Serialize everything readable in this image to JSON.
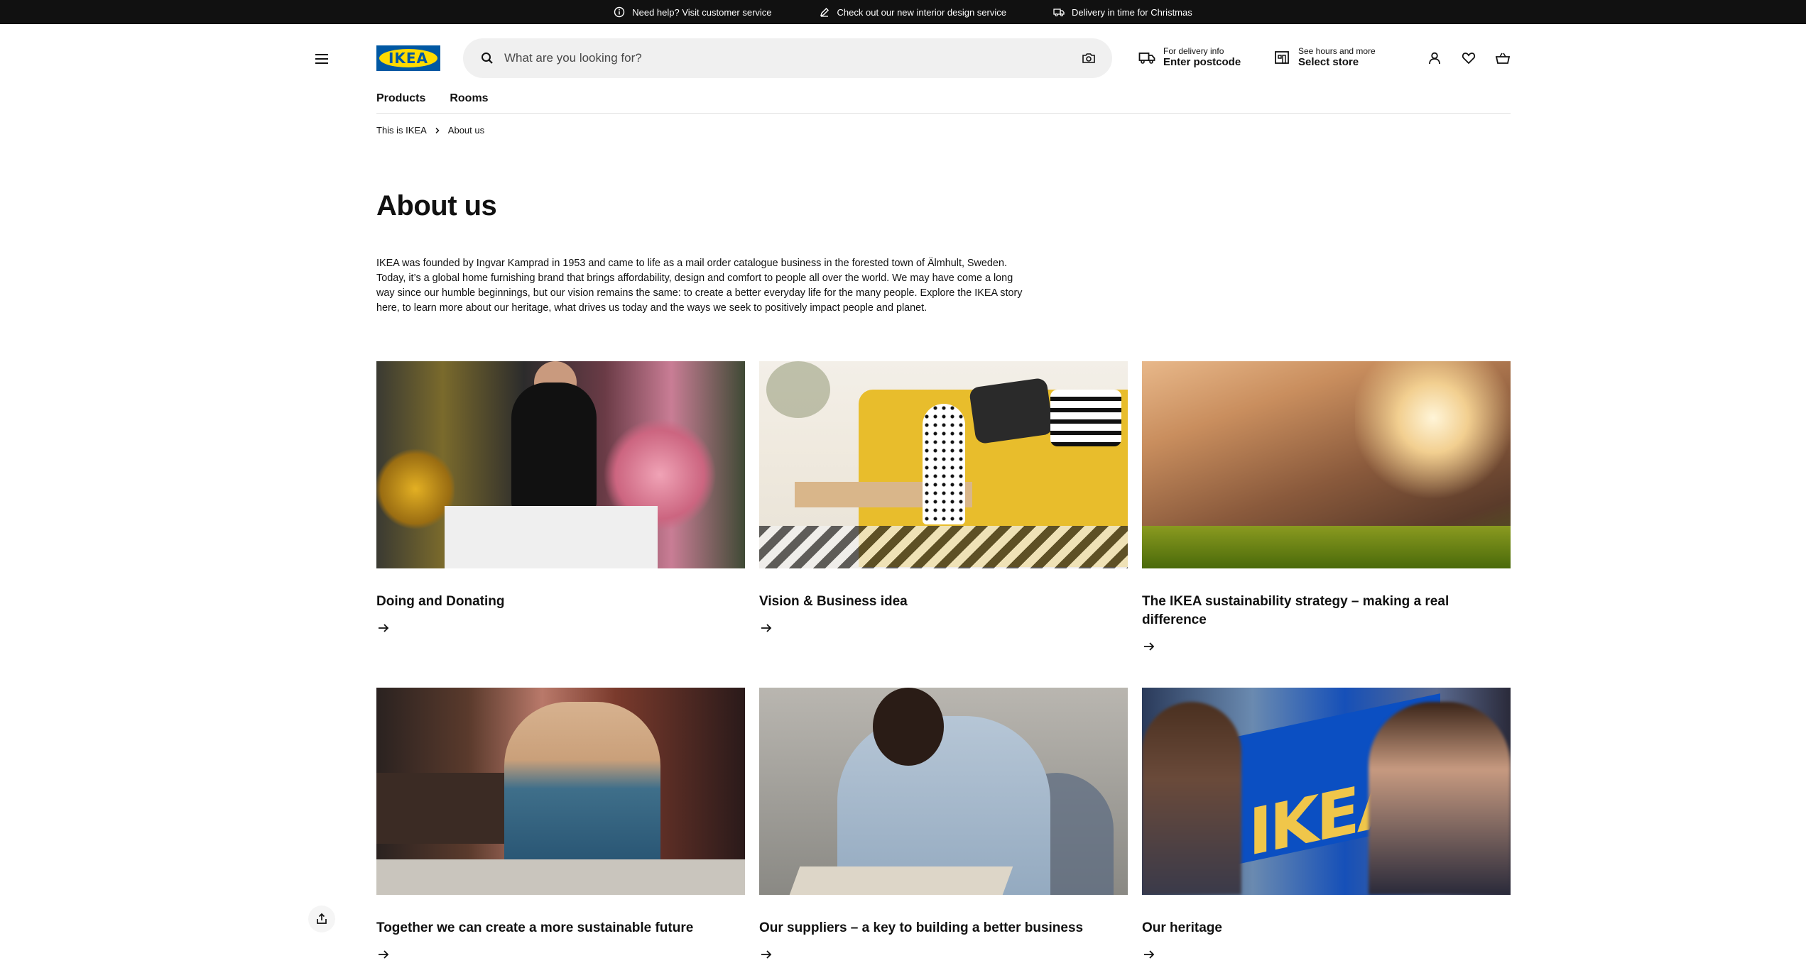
{
  "topbar": {
    "items": [
      {
        "label": "Need help? Visit customer service",
        "icon": "info-icon"
      },
      {
        "label": "Check out our new interior design service",
        "icon": "pencil-icon"
      },
      {
        "label": "Delivery in time for Christmas",
        "icon": "truck-icon"
      }
    ]
  },
  "header": {
    "logo_text": "IKEA",
    "search_placeholder": "What are you looking for?",
    "delivery_small": "For delivery info",
    "delivery_big": "Enter postcode",
    "store_small": "See hours and more",
    "store_big": "Select store"
  },
  "nav": {
    "items": [
      "Products",
      "Rooms"
    ]
  },
  "breadcrumb": {
    "items": [
      "This is IKEA",
      "About us"
    ]
  },
  "page": {
    "title": "About us",
    "intro": "IKEA was founded by Ingvar Kamprad in 1953 and came to life as a mail order catalogue business in the forested town of Älmhult, Sweden. Today, it’s a global home furnishing brand that brings affordability, design and comfort to people all over the world. We may have come a long way since our humble beginnings, but our vision remains the same: to create a better everyday life for the many people. Explore the IKEA story here, to learn more about our heritage, what drives us today and the ways we seek to positively impact people and planet."
  },
  "cards": [
    {
      "title": "Doing and Donating"
    },
    {
      "title": "Vision & Business idea"
    },
    {
      "title": "The IKEA sustainability strategy – making a real difference"
    },
    {
      "title": "Together we can create a more sustainable future"
    },
    {
      "title": "Our suppliers – a key to building a better business"
    },
    {
      "title": "Our heritage"
    }
  ],
  "colors": {
    "brand_blue": "#0058a3",
    "brand_yellow": "#ffdb00",
    "topbar_bg": "#111111"
  }
}
